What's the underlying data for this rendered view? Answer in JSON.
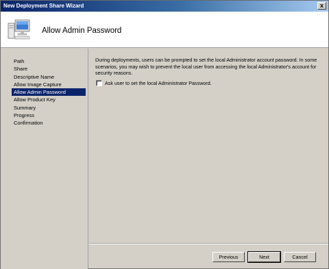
{
  "window": {
    "title": "New Deployment Share Wizard",
    "close_glyph": "x"
  },
  "header": {
    "page_title": "Allow Admin Password",
    "icon": "computer-icon"
  },
  "sidebar": {
    "items": [
      {
        "label": "Path",
        "active": false
      },
      {
        "label": "Share",
        "active": false
      },
      {
        "label": "Descriptive Name",
        "active": false
      },
      {
        "label": "Allow Image Capture",
        "active": false
      },
      {
        "label": "Allow Admin Password",
        "active": true
      },
      {
        "label": "Allow Product Key",
        "active": false
      },
      {
        "label": "Summary",
        "active": false
      },
      {
        "label": "Progress",
        "active": false
      },
      {
        "label": "Confirmation",
        "active": false
      }
    ]
  },
  "main": {
    "description": "During deployments, users can be prompted to set the local Administrator account password. In some scenarios, you may wish to prevent the local user from accessing the local Administrator's account for security reasons.",
    "checkbox_label": "Ask user to set the local Administrator Password.",
    "checkbox_checked": false
  },
  "buttons": {
    "previous": "Previous",
    "next": "Next",
    "cancel": "Cancel"
  },
  "colors": {
    "titlebar_start": "#0a246a",
    "selection": "#0a246a",
    "face": "#d4d0c8"
  }
}
